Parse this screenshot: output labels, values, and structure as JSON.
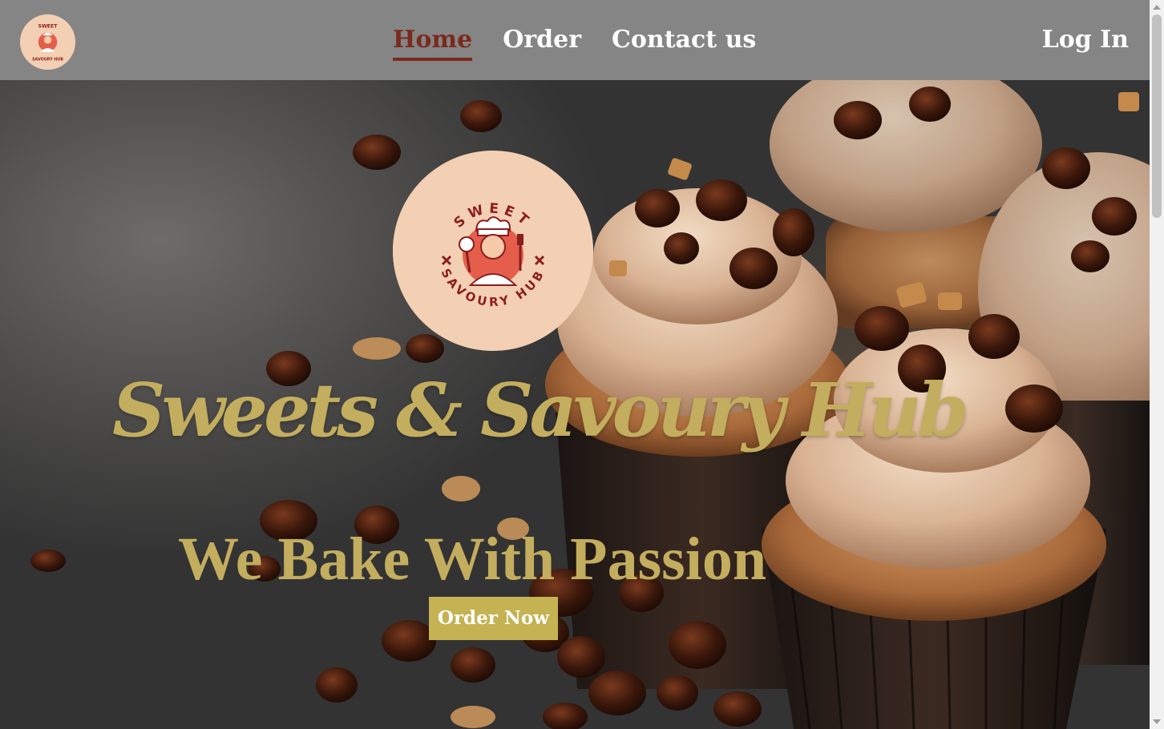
{
  "nav": {
    "logo_text_top": "SWEET",
    "logo_text_bottom": "SAVOURY HUB",
    "links": [
      {
        "label": "Home",
        "active": true
      },
      {
        "label": "Order",
        "active": false
      },
      {
        "label": "Contact us",
        "active": false
      }
    ],
    "login_label": "Log In"
  },
  "hero": {
    "logo_text_top": "SWEET",
    "logo_text_bottom": "SAVOURY HUB",
    "title": "Sweets & Savoury Hub",
    "tagline": "We Bake With Passion",
    "cta_label": "Order Now"
  },
  "colors": {
    "navbar_bg": "#858585",
    "active_link": "#7b2a1e",
    "accent_gold": "#c3ad5e",
    "button_bg": "#c5b253",
    "logo_bg": "#f3cfb4",
    "logo_red": "#c0392b"
  }
}
